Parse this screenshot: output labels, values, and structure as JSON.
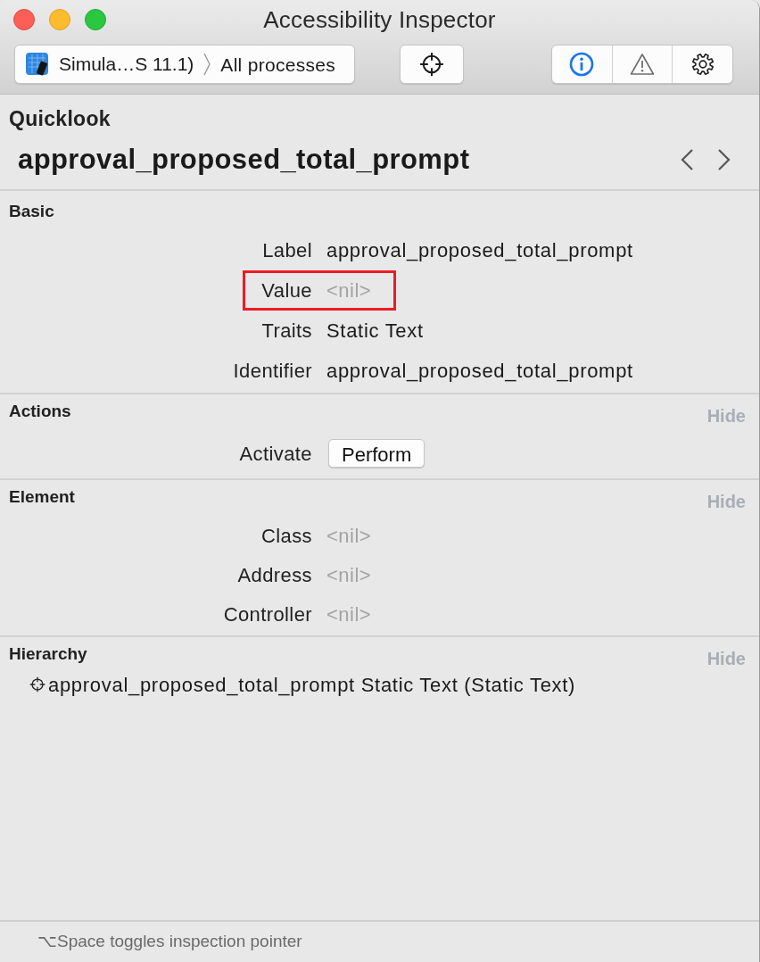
{
  "window": {
    "title": "Accessibility Inspector"
  },
  "toolbar": {
    "target_device": "Simula…S 11.1)",
    "target_process": "All processes",
    "segments": [
      {
        "kind": "info",
        "selected": true
      },
      {
        "kind": "warning",
        "selected": false
      },
      {
        "kind": "settings",
        "selected": false
      }
    ]
  },
  "quicklook": {
    "heading": "Quicklook",
    "title": "approval_proposed_total_prompt"
  },
  "sections": [
    {
      "title": "Basic",
      "rows": [
        {
          "label": "Label",
          "value": "approval_proposed_total_prompt",
          "kind": "text",
          "highlighted": false
        },
        {
          "label": "Value",
          "value": "<nil>",
          "kind": "empty",
          "highlighted": true
        },
        {
          "label": "Traits",
          "value": "Static Text",
          "kind": "text",
          "highlighted": false
        },
        {
          "label": "Identifier",
          "value": "approval_proposed_total_prompt",
          "kind": "text",
          "highlighted": false
        }
      ]
    },
    {
      "title": "Actions",
      "hide_label": "Hide",
      "rows": [
        {
          "label": "Activate",
          "value": "Perform",
          "kind": "button",
          "highlighted": false
        }
      ]
    },
    {
      "title": "Element",
      "hide_label": "Hide",
      "rows": [
        {
          "label": "Class",
          "value": "<nil>",
          "kind": "empty",
          "highlighted": false
        },
        {
          "label": "Address",
          "value": "<nil>",
          "kind": "empty",
          "highlighted": false
        },
        {
          "label": "Controller",
          "value": "<nil>",
          "kind": "empty",
          "highlighted": false
        }
      ]
    },
    {
      "title": "Hierarchy",
      "hide_label": "Hide",
      "tree": [
        {
          "label": "approval_proposed_total_prompt Static Text (Static Text)"
        }
      ]
    }
  ],
  "status_bar": {
    "text": "⌥Space toggles inspection pointer"
  }
}
